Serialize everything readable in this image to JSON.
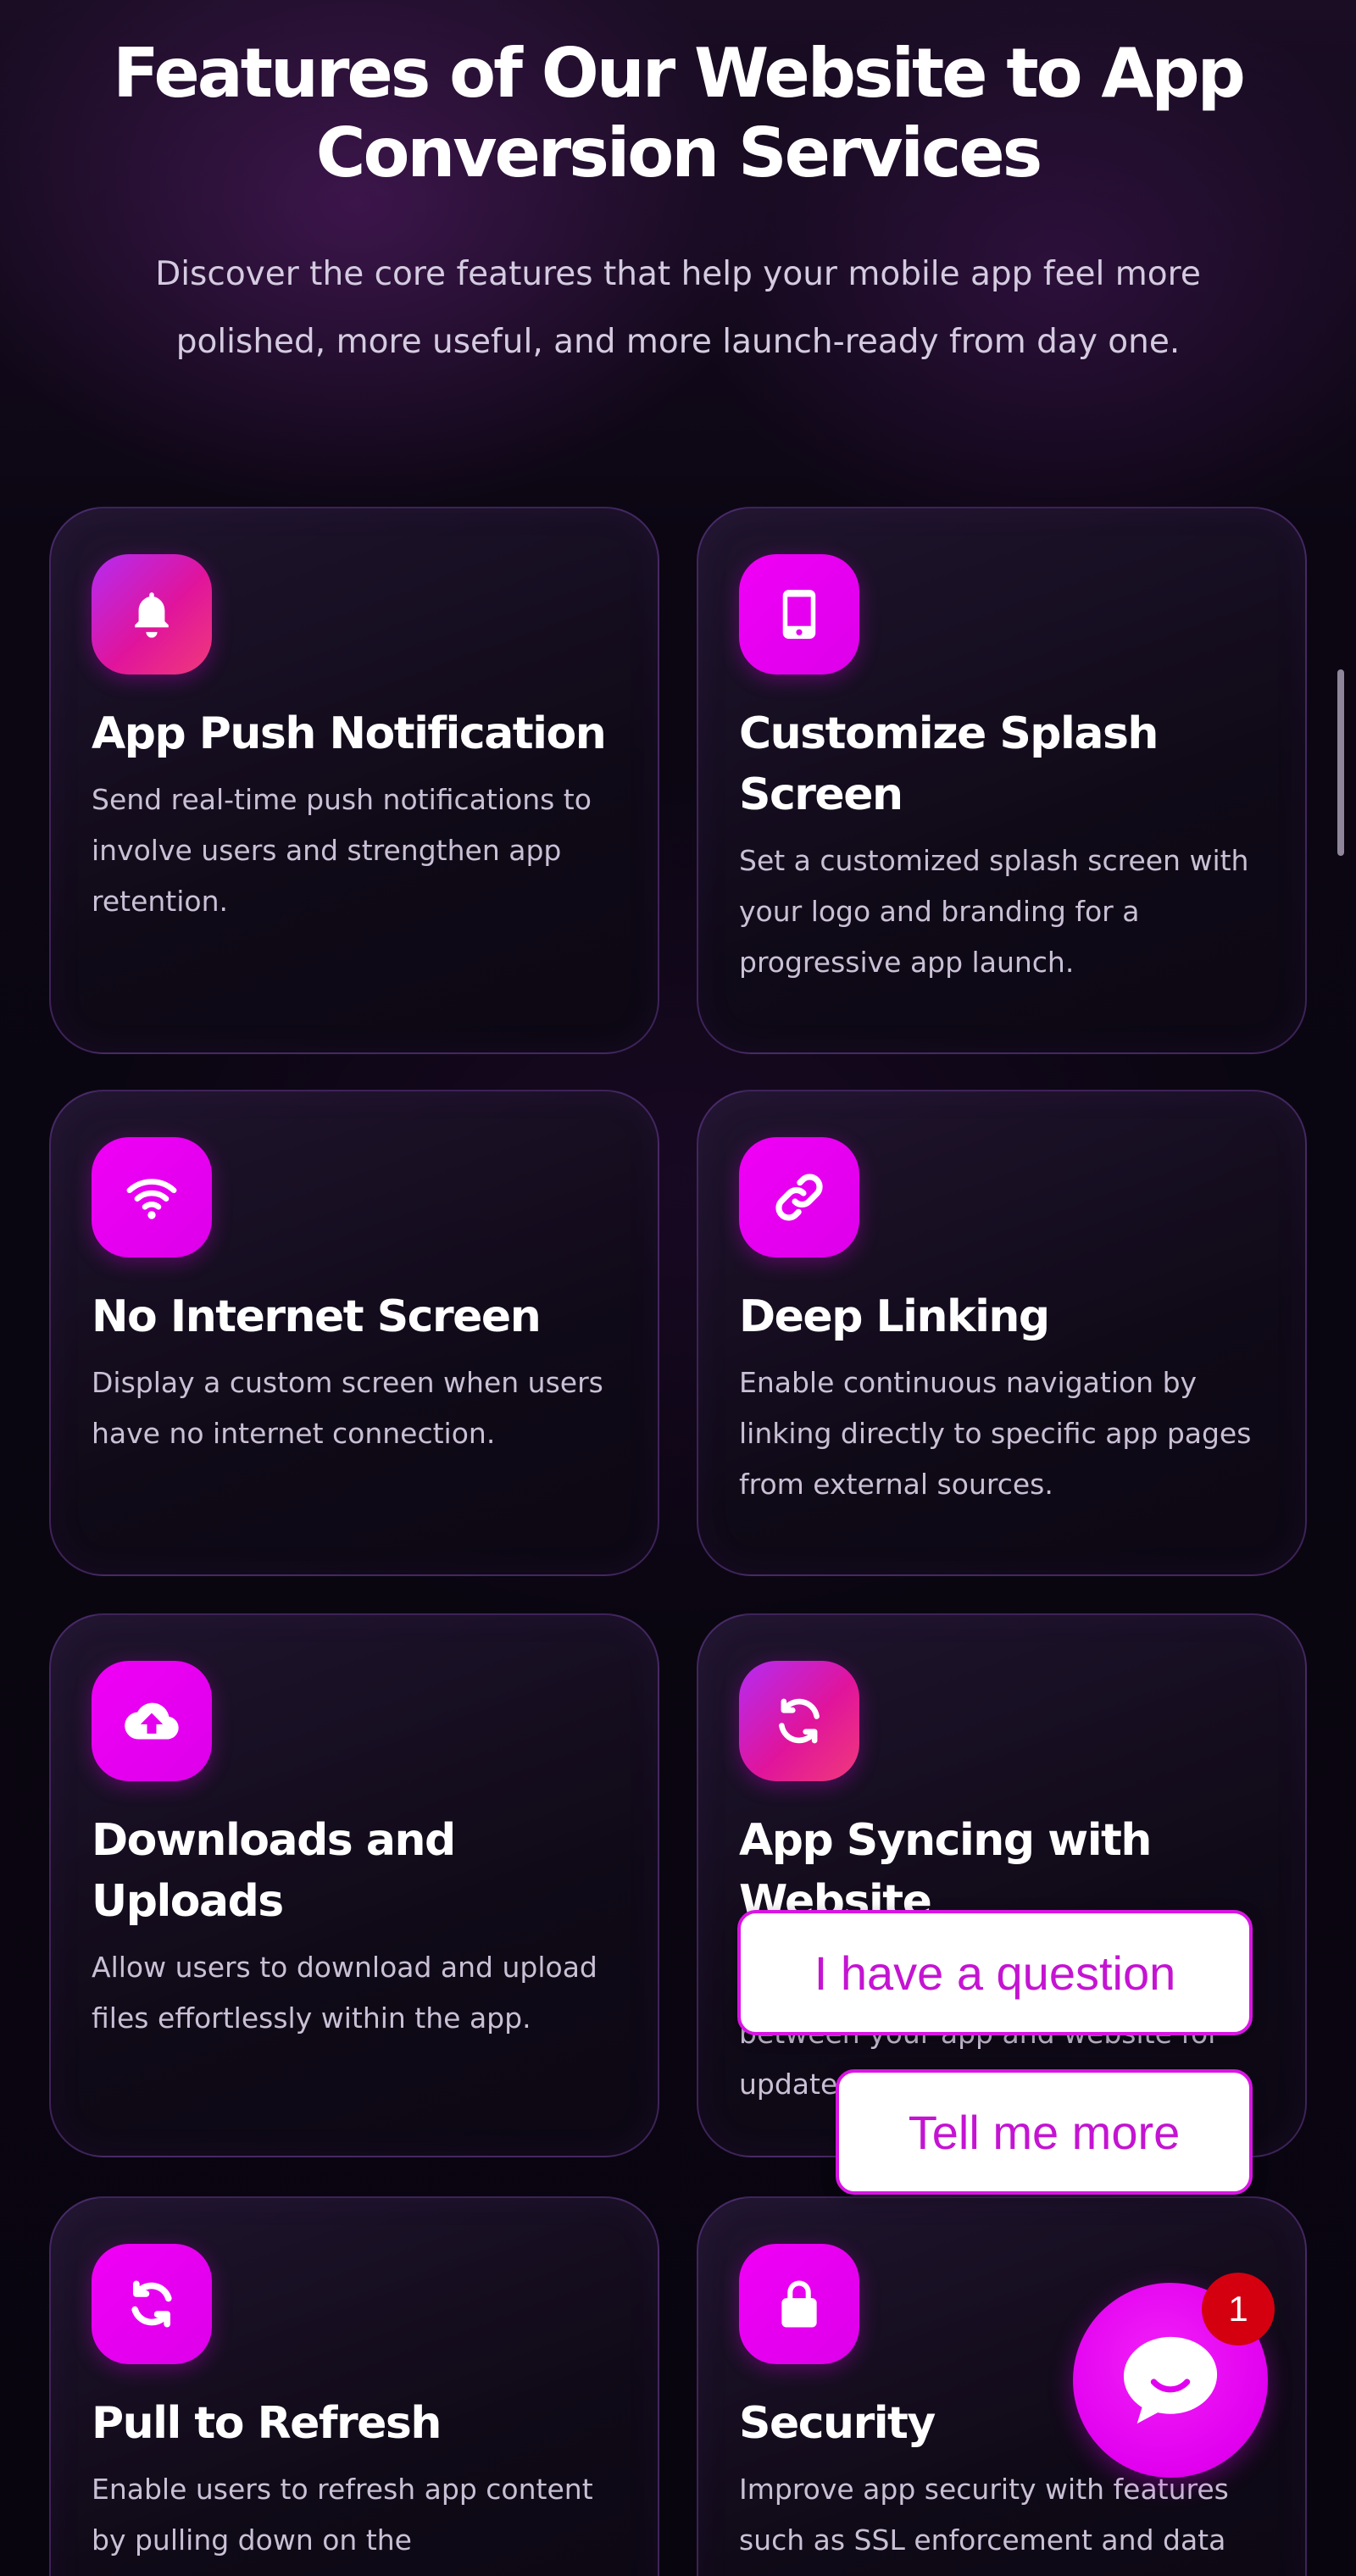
{
  "section": {
    "title_line1": "Features of Our Website to App",
    "title_line2": "Conversion Services",
    "subtitle_line1": "Discover the core features that help your mobile app feel more",
    "subtitle_line2": "polished, more useful, and more launch-ready from day one."
  },
  "features": [
    {
      "icon": "bell-icon",
      "title": "App Push Notification",
      "description": "Send real-time push notifications to involve users and strengthen app retention."
    },
    {
      "icon": "smartphone-icon",
      "title": "Customize Splash Screen",
      "description": "Set a customized splash screen with your logo and branding for a progressive app launch."
    },
    {
      "icon": "wifi-icon",
      "title": "No Internet Screen",
      "description": "Display a custom screen when users have no internet connection."
    },
    {
      "icon": "link-icon",
      "title": "Deep Linking",
      "description": "Enable continuous navigation by linking directly to specific app pages from external sources."
    },
    {
      "icon": "cloud-upload-icon",
      "title": "Downloads and Uploads",
      "description": "Allow users to download and upload files effortlessly within the app."
    },
    {
      "icon": "sync-icon",
      "title": "App Syncing with Website",
      "description_visible_line1": "between your app and website for",
      "description_visible_line2": "update"
    },
    {
      "icon": "refresh-icon",
      "title": "Pull to Refresh",
      "description": "Enable users to refresh app content by pulling down on the"
    },
    {
      "icon": "lock-icon",
      "title": "Security",
      "description": "Improve app security with features such as SSL enforcement and data"
    }
  ],
  "chat": {
    "quick_reply_1": "I have a question",
    "quick_reply_2": "Tell me more",
    "unread_count": "1",
    "accent_color": "#e100ef",
    "badge_color": "#d40010"
  },
  "colors": {
    "background": "#0a0612",
    "icon_tile": "#e600f0",
    "card_border": "#5a2f80",
    "title_text": "#ffffff",
    "body_text": "#c9c0d6"
  }
}
